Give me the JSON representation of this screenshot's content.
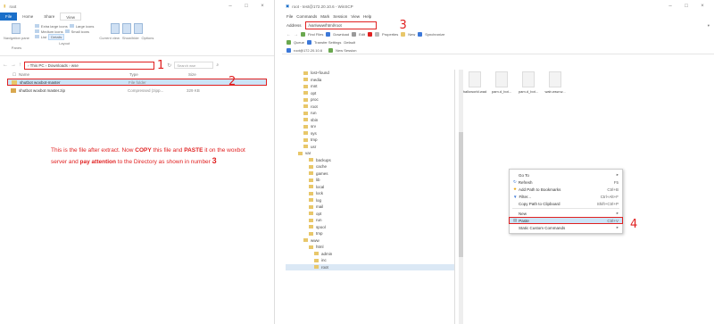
{
  "left_window": {
    "title": "root",
    "tabs": [
      "File",
      "Home",
      "Share",
      "View"
    ],
    "ribbon": {
      "layout_items": [
        "Extra large icons",
        "Large icons",
        "Medium icons",
        "Small icons",
        "List",
        "Details"
      ],
      "current_view_items": [
        "Current view",
        "Show/hide",
        "Options"
      ],
      "nav_pane_label": "Navigation pane",
      "panes_label": "Panes",
      "layout_label": "Layout"
    },
    "address_path": "› This PC › Downloads › wse",
    "search_placeholder": "Search wse",
    "columns": [
      "Name",
      "Type",
      "Size"
    ],
    "files": [
      {
        "name": "shutbot woxbot-master",
        "type": "File folder",
        "size": ""
      },
      {
        "name": "shutbot woxbot master.zip",
        "type": "Compressed (zipp...",
        "size": "329 KB"
      }
    ],
    "annotations": {
      "num1": "1",
      "num2": "2"
    },
    "note": {
      "part1": "This is the file after extract. Now ",
      "copy": "COPY",
      "part2": " this file and ",
      "paste": "PASTE",
      "part3": " it on the woxbot server and ",
      "pay": "pay attention",
      "part4": " to the Directory as shown in number ",
      "num": "3"
    }
  },
  "right_window": {
    "title": "root - test@172.20.10.6 - WinSCP",
    "menu": [
      "File",
      "Commands",
      "Mark",
      "Session",
      "View",
      "Help"
    ],
    "address_label": "Address",
    "address_path": "/var/www/html/root",
    "annotation_num3": "3",
    "toolbar1": [
      "Find Files",
      "Download",
      "Edit",
      "Properties",
      "New",
      "Synchronize"
    ],
    "toolbar2": [
      "Queue",
      "Transfer Settings",
      "Default"
    ],
    "session_tab": "root@172.20.10.6",
    "new_session": "New Session",
    "tree": [
      {
        "name": "lost+found",
        "indent": 1
      },
      {
        "name": "media",
        "indent": 1
      },
      {
        "name": "mnt",
        "indent": 1
      },
      {
        "name": "opt",
        "indent": 1
      },
      {
        "name": "proc",
        "indent": 1
      },
      {
        "name": "root",
        "indent": 1
      },
      {
        "name": "run",
        "indent": 1
      },
      {
        "name": "sbin",
        "indent": 1
      },
      {
        "name": "srv",
        "indent": 1
      },
      {
        "name": "sys",
        "indent": 1
      },
      {
        "name": "tmp",
        "indent": 1
      },
      {
        "name": "usr",
        "indent": 1
      },
      {
        "name": "var",
        "indent": 0
      },
      {
        "name": "backups",
        "indent": 2
      },
      {
        "name": "cache",
        "indent": 2
      },
      {
        "name": "games",
        "indent": 2
      },
      {
        "name": "lib",
        "indent": 2
      },
      {
        "name": "local",
        "indent": 2
      },
      {
        "name": "lock",
        "indent": 2
      },
      {
        "name": "log",
        "indent": 2
      },
      {
        "name": "mail",
        "indent": 2
      },
      {
        "name": "opt",
        "indent": 2
      },
      {
        "name": "run",
        "indent": 2
      },
      {
        "name": "spool",
        "indent": 2
      },
      {
        "name": "tmp",
        "indent": 2
      },
      {
        "name": "www",
        "indent": 1
      },
      {
        "name": "html",
        "indent": 2
      },
      {
        "name": "admin",
        "indent": 3
      },
      {
        "name": "inc",
        "indent": 3
      },
      {
        "name": "root",
        "indent": 3
      }
    ],
    "files": [
      "halloworld.wad",
      "pam.d_bot...",
      "pam.d_bot...",
      "wab.wsw.w..."
    ],
    "context_menu": [
      {
        "label": "Go To",
        "key": "▸"
      },
      {
        "label": "Refresh",
        "key": "F5"
      },
      {
        "label": "Add Path to Bookmarks",
        "key": "Ctrl+B"
      },
      {
        "label": "Filter...",
        "key": "Ctrl+Alt+F"
      },
      {
        "label": "Copy Path to Clipboard",
        "key": "Shift+Ctrl+P"
      },
      {
        "label": "New",
        "key": "▸"
      },
      {
        "label": "Paste",
        "key": "Ctrl+V"
      },
      {
        "label": "Static Custom Commands",
        "key": "▸"
      }
    ],
    "annotation_num4": "4"
  },
  "colors": {
    "annotation": "#e02020",
    "selection": "#cce4f7",
    "accent": "#1a6fc9"
  }
}
